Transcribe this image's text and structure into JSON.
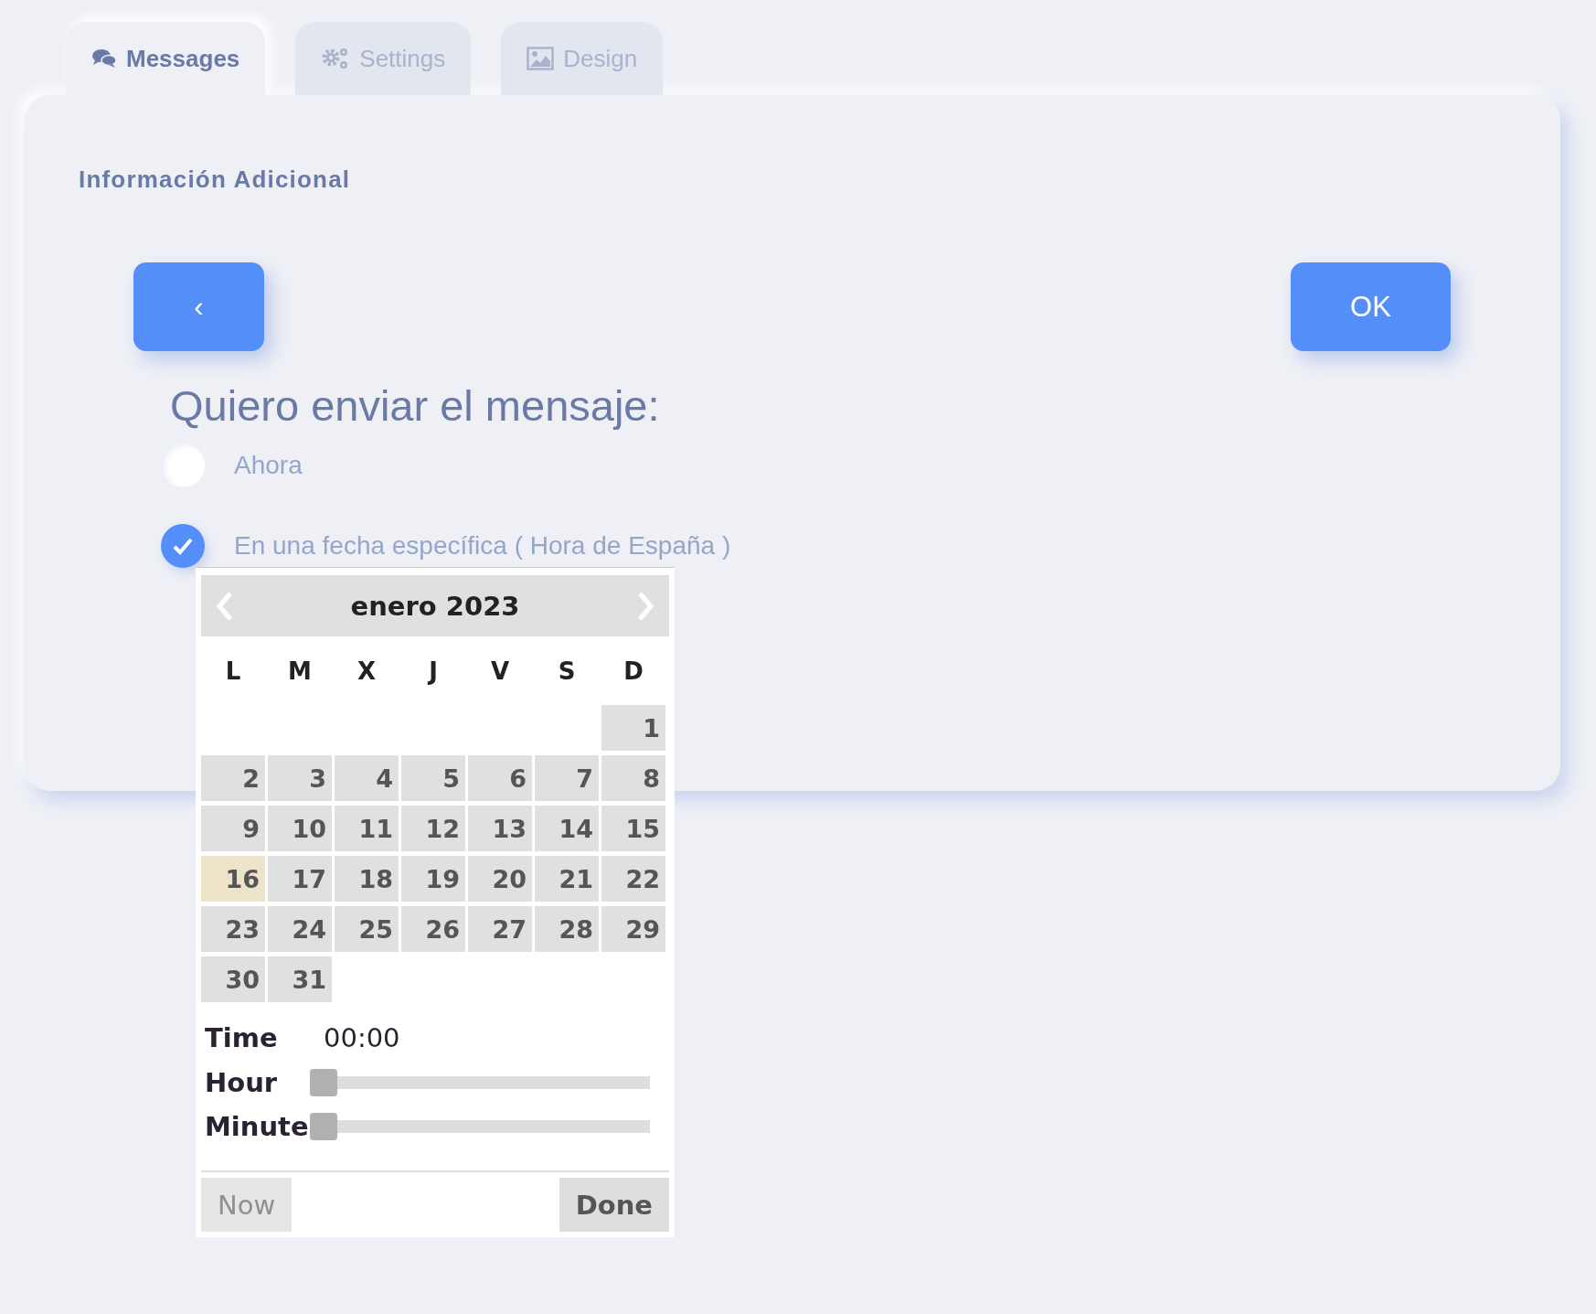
{
  "tabs": [
    {
      "label": "Messages",
      "selected": true
    },
    {
      "label": "Settings",
      "selected": false
    },
    {
      "label": "Design",
      "selected": false
    }
  ],
  "card": {
    "title": "Información Adicional",
    "back_button": "‹",
    "ok_button": "OK",
    "question": "Quiero enviar el mensaje:",
    "options": [
      {
        "label": "Ahora",
        "selected": false
      },
      {
        "label": "En una fecha específica ( Hora de España )",
        "selected": true
      }
    ]
  },
  "datepicker": {
    "month": "enero 2023",
    "weekdays": [
      "L",
      "M",
      "X",
      "J",
      "V",
      "S",
      "D"
    ],
    "weeks": [
      [
        {
          "day": "1",
          "highlighted": false
        }
      ],
      [
        {
          "day": "2",
          "highlighted": false
        },
        {
          "day": "3",
          "highlighted": false
        },
        {
          "day": "4",
          "highlighted": false
        },
        {
          "day": "5",
          "highlighted": false
        },
        {
          "day": "6",
          "highlighted": false
        },
        {
          "day": "7",
          "highlighted": false
        },
        {
          "day": "8",
          "highlighted": false
        }
      ],
      [
        {
          "day": "9",
          "highlighted": false
        },
        {
          "day": "10",
          "highlighted": false
        },
        {
          "day": "11",
          "highlighted": false
        },
        {
          "day": "12",
          "highlighted": false
        },
        {
          "day": "13",
          "highlighted": false
        },
        {
          "day": "14",
          "highlighted": false
        },
        {
          "day": "15",
          "highlighted": false
        }
      ],
      [
        {
          "day": "16",
          "highlighted": true
        },
        {
          "day": "17",
          "highlighted": false
        },
        {
          "day": "18",
          "highlighted": false
        },
        {
          "day": "19",
          "highlighted": false
        },
        {
          "day": "20",
          "highlighted": false
        },
        {
          "day": "21",
          "highlighted": false
        },
        {
          "day": "22",
          "highlighted": false
        }
      ],
      [
        {
          "day": "23",
          "highlighted": false
        },
        {
          "day": "24",
          "highlighted": false
        },
        {
          "day": "25",
          "highlighted": false
        },
        {
          "day": "26",
          "highlighted": false
        },
        {
          "day": "27",
          "highlighted": false
        },
        {
          "day": "28",
          "highlighted": false
        },
        {
          "day": "29",
          "highlighted": false
        }
      ],
      [
        {
          "day": "30",
          "highlighted": false
        },
        {
          "day": "31",
          "highlighted": false
        }
      ]
    ],
    "time_label": "Time",
    "time_value": "00:00",
    "sliders": [
      {
        "label": "Hour",
        "level": 0
      },
      {
        "label": "Minute",
        "level": 0
      }
    ],
    "now_button": "Now",
    "done_button": "Done"
  }
}
